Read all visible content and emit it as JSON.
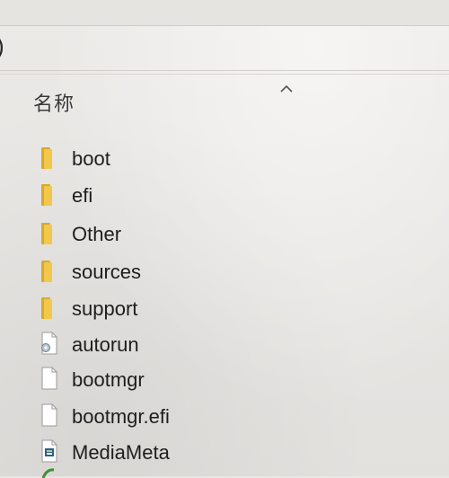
{
  "window": {
    "address_fragment": ")"
  },
  "column_header": {
    "name_label": "名称",
    "sort_icon": "chevron-up-icon"
  },
  "files": [
    {
      "name": "boot",
      "type": "folder",
      "icon": "folder-icon"
    },
    {
      "name": "efi",
      "type": "folder",
      "icon": "folder-icon"
    },
    {
      "name": "Other",
      "type": "folder",
      "icon": "folder-icon"
    },
    {
      "name": "sources",
      "type": "folder",
      "icon": "folder-icon"
    },
    {
      "name": "support",
      "type": "folder",
      "icon": "folder-icon"
    },
    {
      "name": "autorun",
      "type": "settings-file",
      "icon": "settings-file-icon"
    },
    {
      "name": "bootmgr",
      "type": "file",
      "icon": "blank-file-icon"
    },
    {
      "name": "bootmgr.efi",
      "type": "file",
      "icon": "blank-file-icon"
    },
    {
      "name": "MediaMeta",
      "type": "xml-file",
      "icon": "xml-file-icon"
    }
  ],
  "colors": {
    "folder": "#f1c84b",
    "folder_dark": "#d9a92a",
    "text": "#1e1e1e",
    "background": "#e9e7e4"
  }
}
